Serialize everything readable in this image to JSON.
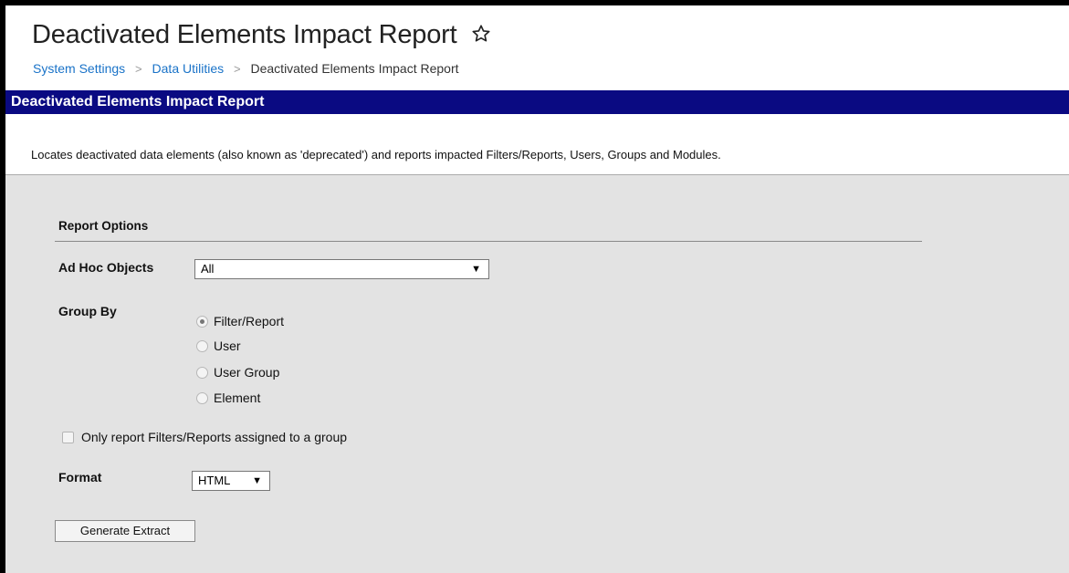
{
  "header": {
    "title": "Deactivated Elements Impact Report",
    "breadcrumb": [
      "System Settings",
      "Data Utilities",
      "Deactivated Elements Impact Report"
    ]
  },
  "banner": {
    "title": "Deactivated Elements Impact Report"
  },
  "description": "Locates deactivated data elements (also known as 'deprecated') and reports impacted Filters/Reports, Users, Groups and Modules.",
  "report_options": {
    "section_title": "Report Options",
    "ad_hoc_objects": {
      "label": "Ad Hoc Objects",
      "value": "All"
    },
    "group_by": {
      "label": "Group By",
      "options": [
        "Filter/Report",
        "User",
        "User Group",
        "Element"
      ],
      "selected": "Filter/Report"
    },
    "only_assigned": {
      "label": "Only report Filters/Reports assigned to a group",
      "checked": false
    },
    "format": {
      "label": "Format",
      "value": "HTML"
    },
    "generate_button": "Generate Extract"
  },
  "icons": {
    "favorite": "star-outline-icon",
    "breadcrumb_separator": "chevron-right-icon",
    "dropdown": "caret-down-icon"
  },
  "colors": {
    "banner_bg": "#0a0a82",
    "link": "#1a73c8",
    "panel_bg": "#e3e3e3"
  }
}
